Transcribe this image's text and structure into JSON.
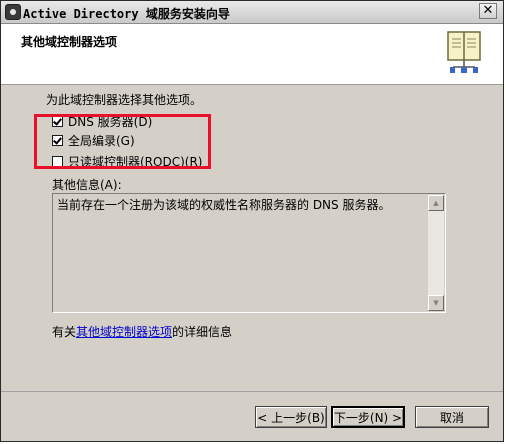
{
  "window": {
    "title": "Active Directory 域服务安装向导",
    "close_label": "✕"
  },
  "header": {
    "title": "其他域控制器选项"
  },
  "intro": "为此域控制器选择其他选项。",
  "options": [
    {
      "label": "DNS 服务器(D)",
      "checked": true
    },
    {
      "label": "全局编录(G)",
      "checked": true
    },
    {
      "label": "只读域控制器(RODC)(R)",
      "checked": false
    }
  ],
  "info": {
    "label": "其他信息(A):",
    "text": "当前存在一个注册为该域的权威性名称服务器的 DNS 服务器。"
  },
  "more_info": {
    "prefix": "有关",
    "link": "其他域控制器选项",
    "suffix": "的详细信息"
  },
  "buttons": {
    "back": "< 上一步(B)",
    "next": "下一步(N) >",
    "cancel": "取消"
  },
  "icons": {
    "header": "book-icon",
    "scroll_up": "scroll-up-icon",
    "scroll_down": "scroll-down-icon"
  },
  "colors": {
    "highlight": "#e8102a",
    "link": "#0000cc"
  }
}
